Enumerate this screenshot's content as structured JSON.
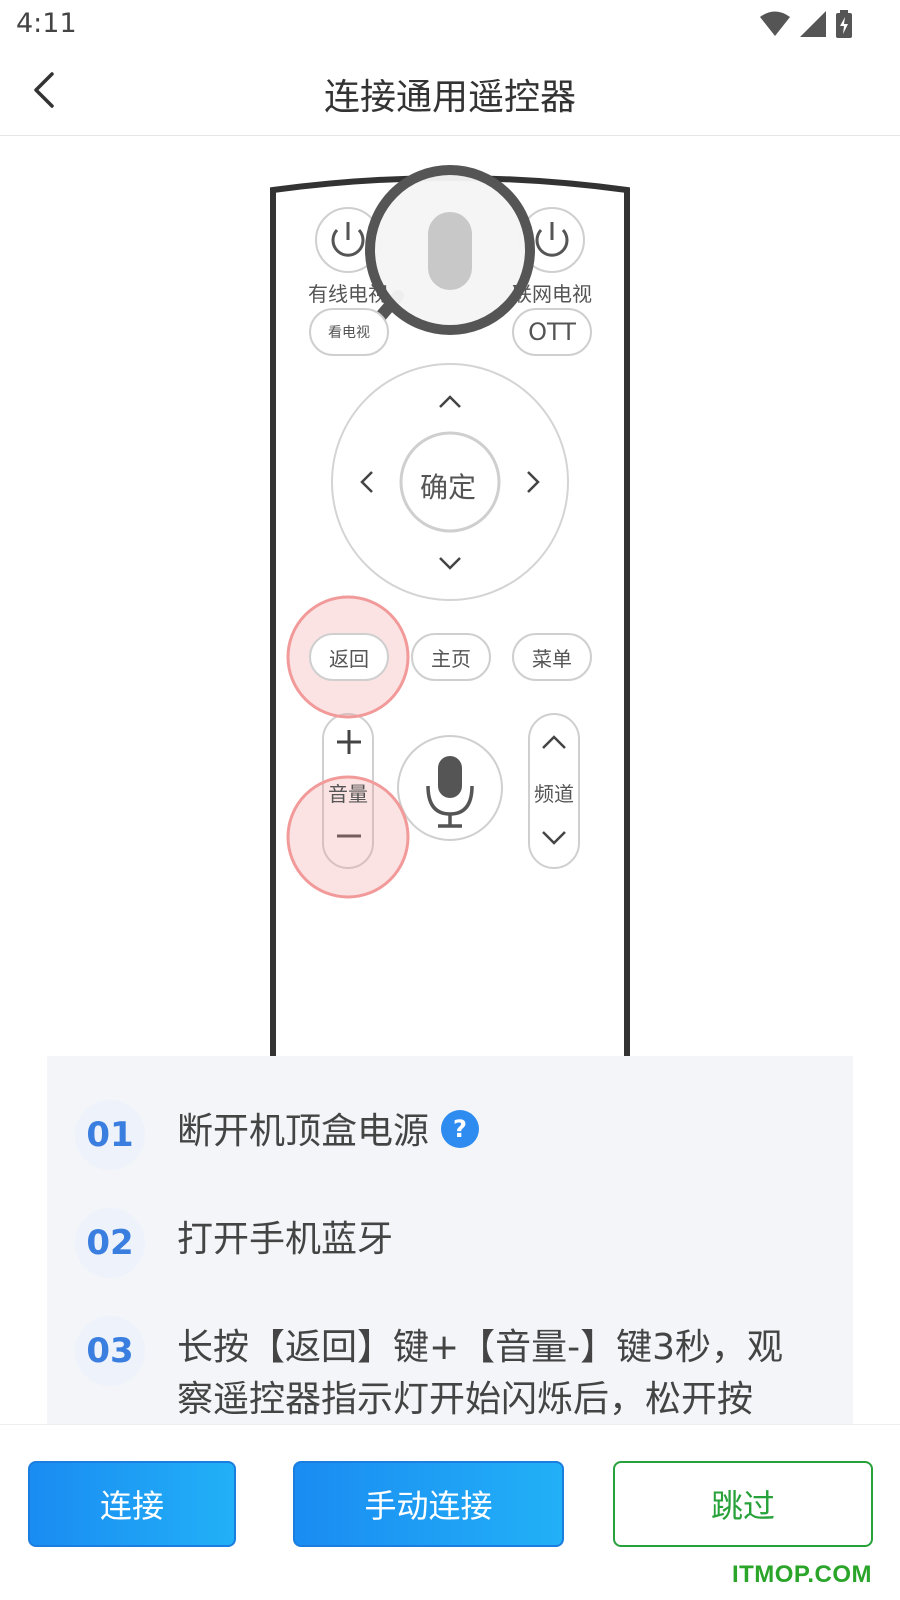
{
  "status_bar": {
    "time": "4:11"
  },
  "header": {
    "title": "连接通用遥控器",
    "back_icon": "chevron-left-icon"
  },
  "remote": {
    "left_power_label": "有线电视",
    "right_power_label": "联网电视",
    "tv_button_label": "看电视",
    "ott_label": "OTT",
    "ok_label": "确定",
    "back_label": "返回",
    "home_label": "主页",
    "menu_label": "菜单",
    "volume_label": "音量",
    "channel_label": "频道",
    "highlight_color": "#f29a9a"
  },
  "steps": [
    {
      "num": "01",
      "text": "断开机顶盒电源",
      "help": "?"
    },
    {
      "num": "02",
      "text": "打开手机蓝牙"
    },
    {
      "num": "03",
      "text": "长按【返回】键+【音量-】键3秒，观察遥控器指示灯开始闪烁后，松开按"
    }
  ],
  "buttons": {
    "connect": "连接",
    "manual_connect": "手动连接",
    "skip": "跳过"
  },
  "colors": {
    "primary": "#1a8cf2",
    "skip": "#27a13a",
    "step_number": "#3a7ee0"
  },
  "watermark": "ITMOP.COM"
}
